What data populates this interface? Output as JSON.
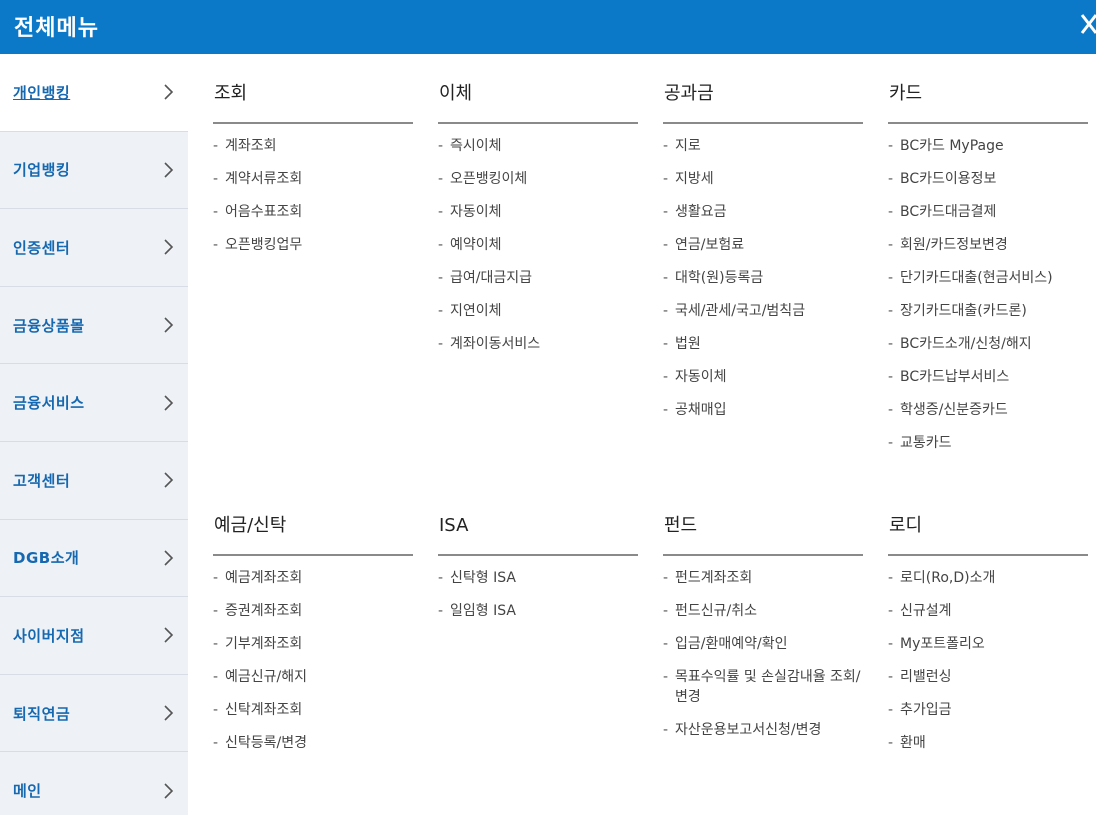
{
  "header": {
    "title": "전체메뉴"
  },
  "sidebar": {
    "items": [
      {
        "label": "개인뱅킹",
        "active": true
      },
      {
        "label": "기업뱅킹"
      },
      {
        "label": "인증센터"
      },
      {
        "label": "금융상품몰"
      },
      {
        "label": "금융서비스"
      },
      {
        "label": "고객센터"
      },
      {
        "label": "DGB소개"
      },
      {
        "label": "사이버지점"
      },
      {
        "label": "퇴직연금"
      },
      {
        "label": "메인"
      }
    ]
  },
  "sections": [
    {
      "title": "조회",
      "items": [
        "계좌조회",
        "계약서류조회",
        "어음수표조회",
        "오픈뱅킹업무"
      ]
    },
    {
      "title": "이체",
      "items": [
        "즉시이체",
        "오픈뱅킹이체",
        "자동이체",
        "예약이체",
        "급여/대금지급",
        "지연이체",
        "계좌이동서비스"
      ]
    },
    {
      "title": "공과금",
      "items": [
        "지로",
        "지방세",
        "생활요금",
        "연금/보험료",
        "대학(원)등록금",
        "국세/관세/국고/범칙금",
        "법원",
        "자동이체",
        "공채매입"
      ]
    },
    {
      "title": "카드",
      "items": [
        "BC카드 MyPage",
        "BC카드이용정보",
        "BC카드대금결제",
        "회원/카드정보변경",
        "단기카드대출(현금서비스)",
        "장기카드대출(카드론)",
        "BC카드소개/신청/해지",
        "BC카드납부서비스",
        "학생증/신분증카드",
        "교통카드"
      ]
    },
    {
      "title": "예금/신탁",
      "items": [
        "예금계좌조회",
        "증권계좌조회",
        "기부계좌조회",
        "예금신규/해지",
        "신탁계좌조회",
        "신탁등록/변경"
      ]
    },
    {
      "title": "ISA",
      "items": [
        "신탁형 ISA",
        "일임형 ISA"
      ]
    },
    {
      "title": "펀드",
      "items": [
        "펀드계좌조회",
        "펀드신규/취소",
        "입금/환매예약/확인",
        "목표수익률 및 손실감내율 조회/변경",
        "자산운용보고서신청/변경"
      ]
    },
    {
      "title": "로디",
      "items": [
        "로디(Ro,D)소개",
        "신규설계",
        "My포트폴리오",
        "리밸런싱",
        "추가입금",
        "환매"
      ]
    }
  ],
  "colors": {
    "header_bg": "#0b78c8",
    "sidebar_bg": "#eef2f6",
    "sidebar_text": "#1668b0"
  },
  "icons": {
    "close": "close-icon",
    "chevron": "chevron-right-icon"
  }
}
